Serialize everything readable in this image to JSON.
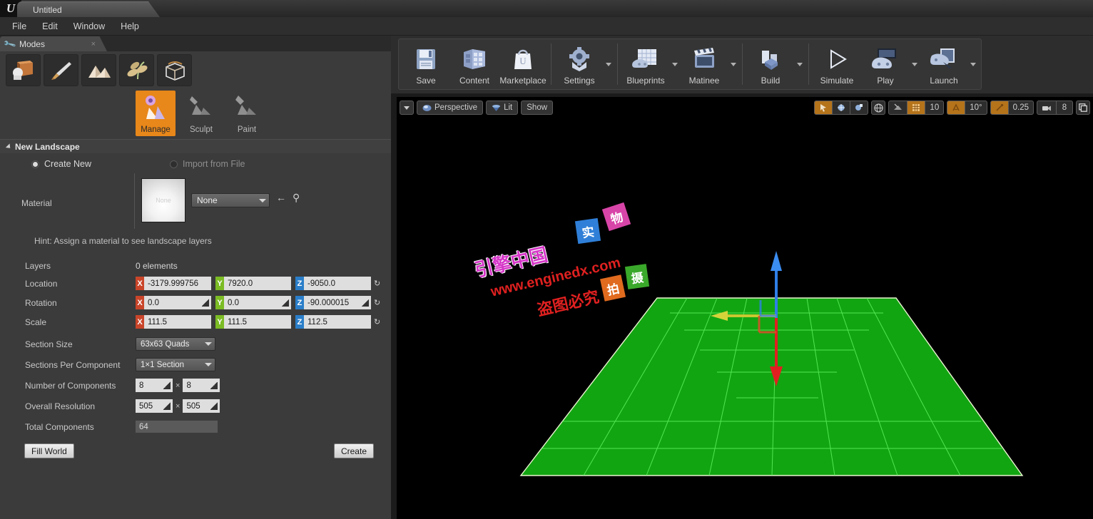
{
  "window": {
    "logo": "U",
    "document_title": "Untitled"
  },
  "menubar": {
    "items": [
      "File",
      "Edit",
      "Window",
      "Help"
    ]
  },
  "left_panel": {
    "tab": {
      "label": "Modes",
      "icon": "wrench-icon",
      "close": "×"
    },
    "modes": [
      {
        "name": "place-mode",
        "active": false
      },
      {
        "name": "paint-mode",
        "active": false
      },
      {
        "name": "landscape-mode",
        "active": false
      },
      {
        "name": "foliage-mode",
        "active": false
      },
      {
        "name": "geometry-editing-mode",
        "active": false
      }
    ],
    "landscape_tools": [
      {
        "label": "Manage",
        "active": true
      },
      {
        "label": "Sculpt",
        "active": false
      },
      {
        "label": "Paint",
        "active": false
      }
    ],
    "section": {
      "title": "New Landscape"
    },
    "mode_radio": [
      {
        "label": "Create New",
        "selected": true
      },
      {
        "label": "Import from File",
        "selected": false
      }
    ],
    "material": {
      "label": "Material",
      "thumbnail_caption": "None",
      "combo_value": "None",
      "back_icon": "←",
      "browse_icon": "⚲"
    },
    "hint": "Hint: Assign a material to see landscape layers",
    "properties": {
      "layers": {
        "label": "Layers",
        "value": "0 elements"
      },
      "location": {
        "label": "Location",
        "x": "-3179.999756",
        "y": "7920.0",
        "z": "-9050.0"
      },
      "rotation": {
        "label": "Rotation",
        "x": "0.0",
        "y": "0.0",
        "z": "-90.000015"
      },
      "scale": {
        "label": "Scale",
        "x": "111.5",
        "y": "111.5",
        "z": "112.5"
      },
      "section_size": {
        "label": "Section Size",
        "value": "63x63 Quads"
      },
      "sections_per_component": {
        "label": "Sections Per Component",
        "value": "1×1 Section"
      },
      "number_of_components": {
        "label": "Number of Components",
        "w": "8",
        "h": "8",
        "sep": "×"
      },
      "overall_resolution": {
        "label": "Overall Resolution",
        "w": "505",
        "h": "505",
        "sep": "×"
      },
      "total_components": {
        "label": "Total Components",
        "value": "64"
      }
    },
    "buttons": {
      "fill_world": "Fill World",
      "create": "Create"
    },
    "axis_colors": {
      "x": "#c9452a",
      "y": "#7bbb24",
      "z": "#2a7ec9"
    }
  },
  "toolbar": {
    "groups": [
      {
        "items": [
          {
            "label": "Save",
            "icon": "save-icon",
            "dropdown": false
          },
          {
            "label": "Content",
            "icon": "content-browser-icon",
            "dropdown": false
          },
          {
            "label": "Marketplace",
            "icon": "marketplace-bag-icon",
            "dropdown": false
          }
        ]
      },
      {
        "items": [
          {
            "label": "Settings",
            "icon": "settings-gear-icon",
            "dropdown": true
          }
        ]
      },
      {
        "items": [
          {
            "label": "Blueprints",
            "icon": "blueprints-icon",
            "dropdown": true
          },
          {
            "label": "Matinee",
            "icon": "matinee-clapboard-icon",
            "dropdown": true
          }
        ]
      },
      {
        "items": [
          {
            "label": "Build",
            "icon": "build-cubes-icon",
            "dropdown": true
          }
        ]
      },
      {
        "items": [
          {
            "label": "Simulate",
            "icon": "simulate-play-icon",
            "dropdown": false
          },
          {
            "label": "Play",
            "icon": "play-gamepad-icon",
            "dropdown": true
          },
          {
            "label": "Launch",
            "icon": "launch-device-icon",
            "dropdown": true
          }
        ]
      }
    ]
  },
  "viewport": {
    "left_controls": [
      {
        "name": "viewport-options-menu",
        "label": "",
        "icon": "chevron-down-icon"
      },
      {
        "name": "camera-mode",
        "label": "Perspective",
        "icon": "camera-icon"
      },
      {
        "name": "view-mode",
        "label": "Lit",
        "icon": "lit-icon"
      },
      {
        "name": "show-menu",
        "label": "Show",
        "icon": ""
      }
    ],
    "right_controls": {
      "transform_group": [
        {
          "name": "select-mode",
          "icon": "select-arrow-icon",
          "active": true
        },
        {
          "name": "translate-mode",
          "icon": "translate-icon",
          "active": false
        },
        {
          "name": "rotate-scale-mode",
          "icon": "scale-icon",
          "active": false
        }
      ],
      "coordinate_system": {
        "name": "world-coordinate-toggle",
        "icon": "globe-icon"
      },
      "grid_group": [
        {
          "name": "surface-snap",
          "icon": "surface-snap-icon",
          "active": false
        },
        {
          "name": "grid-snap-toggle",
          "icon": "grid-icon",
          "active": true
        },
        {
          "name": "grid-snap-value",
          "value": "10"
        }
      ],
      "rotation_group": [
        {
          "name": "rotation-snap-toggle",
          "icon": "rotation-snap-icon",
          "active": true
        },
        {
          "name": "rotation-snap-value",
          "value": "10°"
        }
      ],
      "scale_group": [
        {
          "name": "scale-snap-toggle",
          "icon": "scale-snap-icon",
          "active": true
        },
        {
          "name": "scale-snap-value",
          "value": "0.25"
        }
      ],
      "camera_group": [
        {
          "name": "camera-speed-toggle",
          "icon": "camera-speed-icon",
          "active": false
        },
        {
          "name": "camera-speed-value",
          "value": "8"
        }
      ],
      "maximize": {
        "name": "maximize-viewport-button",
        "icon": "maximize-icon"
      }
    },
    "watermark": {
      "brand": "引擎中国",
      "url": "www.enginedx.com",
      "notice": "盗图必究",
      "blocks": [
        {
          "char": "实",
          "color": "#2f7fd8"
        },
        {
          "char": "物",
          "color": "#d845a8"
        },
        {
          "char": "拍",
          "color": "#e06a1e"
        },
        {
          "char": "摄",
          "color": "#3aa82a"
        }
      ]
    },
    "scene": {
      "landscape_color": "#12a512",
      "grid_line_color": "#5df25d",
      "gizmo": {
        "z_up_color": "#2f7fe8",
        "z_down_color": "#e02020",
        "y_color": "#c8c830"
      }
    }
  }
}
